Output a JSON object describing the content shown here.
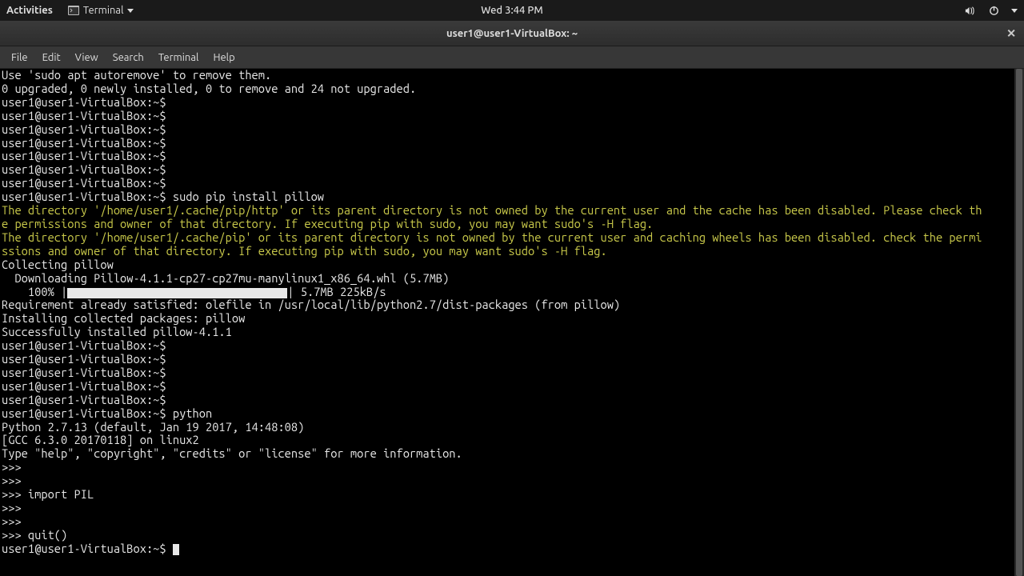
{
  "panel": {
    "activities": "Activities",
    "app_menu_label": "Terminal",
    "clock": "Wed  3:44 PM"
  },
  "window": {
    "title": "user1@user1-VirtualBox: ~"
  },
  "menubar": [
    "File",
    "Edit",
    "View",
    "Search",
    "Terminal",
    "Help"
  ],
  "term": {
    "l0": "Use 'sudo apt autoremove' to remove them.",
    "l1": "0 upgraded, 0 newly installed, 0 to remove and 24 not upgraded.",
    "prompt": "user1@user1-VirtualBox:~$ ",
    "cmd_pip": "sudo pip install pillow",
    "warn1": "The directory '/home/user1/.cache/pip/http' or its parent directory is not owned by the current user and the cache has been disabled. Please check th",
    "warn1b": "e permissions and owner of that directory. If executing pip with sudo, you may want sudo's -H flag.",
    "warn2": "The directory '/home/user1/.cache/pip' or its parent directory is not owned by the current user and caching wheels has been disabled. check the permi",
    "warn2b": "ssions and owner of that directory. If executing pip with sudo, you may want sudo's -H flag.",
    "collecting": "Collecting pillow",
    "downloading": "  Downloading Pillow-4.1.1-cp27-cp27mu-manylinux1_x86_64.whl (5.7MB)",
    "progress_pre": "    100% |",
    "progress_post": "| 5.7MB 225kB/s ",
    "req": "Requirement already satisfied: olefile in /usr/local/lib/python2.7/dist-packages (from pillow)",
    "installing": "Installing collected packages: pillow",
    "success": "Successfully installed pillow-4.1.1",
    "cmd_python": "python",
    "py1": "Python 2.7.13 (default, Jan 19 2017, 14:48:08) ",
    "py2": "[GCC 6.3.0 20170118] on linux2",
    "py3": "Type \"help\", \"copyright\", \"credits\" or \"license\" for more information.",
    "pyprompt": ">>> ",
    "py_import": "import PIL",
    "py_quit": "quit()"
  }
}
